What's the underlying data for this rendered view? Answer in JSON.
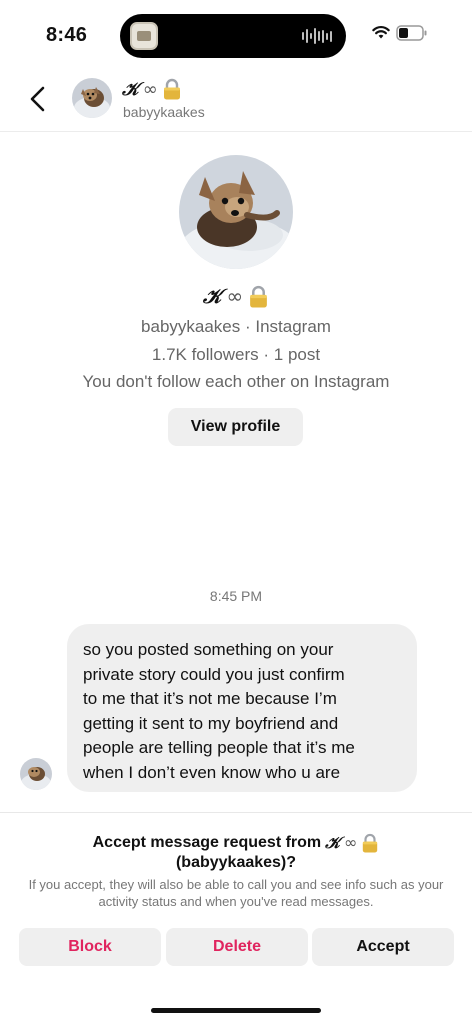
{
  "status_bar": {
    "time": "8:46"
  },
  "header": {
    "back_icon": "chevron-left-icon",
    "name_initial": "𝒦",
    "name_symbol": "∞",
    "username": "babyykaakes"
  },
  "profile": {
    "name_initial": "𝒦",
    "name_symbol": "∞",
    "line_username": "babyykaakes · Instagram",
    "line_stats": "1.7K followers · 1 post",
    "line_relation": "You don't follow each other on Instagram",
    "view_profile_label": "View profile"
  },
  "thread": {
    "timestamp": "8:45 PM",
    "message_lines": [
      "so you posted something on your",
      "private story could you just confirm",
      "to me that it’s not me because I’m",
      "getting it sent to my boyfriend and",
      "people are telling people that it’s me",
      "when I don’t even know who u are"
    ]
  },
  "request": {
    "title_prefix": "Accept message request from",
    "title_initial": "𝒦",
    "title_symbol": "∞",
    "title_username": "(babyykaakes)?",
    "info": "If you accept, they will also be able to call you and see info such as your activity status and when you've read messages.",
    "block_label": "Block",
    "delete_label": "Delete",
    "accept_label": "Accept"
  },
  "colors": {
    "destructive": "#e0245e",
    "button_bg": "#efefef"
  }
}
